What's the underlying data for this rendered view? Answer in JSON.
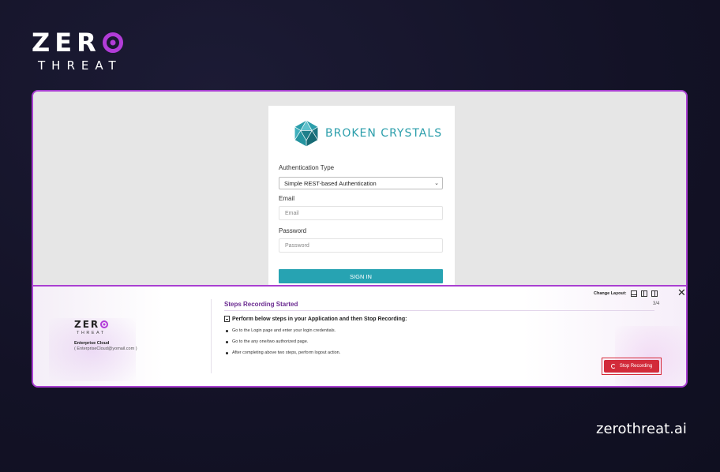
{
  "brand": {
    "word_top_prefix": "ZER",
    "word_bottom": "THREAT"
  },
  "login": {
    "logo_title": "BROKEN CRYSTALS",
    "auth_label": "Authentication Type",
    "auth_value": "Simple REST-based Authentication",
    "email_label": "Email",
    "email_placeholder": "Email",
    "password_label": "Password",
    "password_placeholder": "Password",
    "signin_label": "SIGN IN"
  },
  "panel": {
    "mini_brand_prefix": "ZER",
    "mini_brand_bottom": "THREAT",
    "enterprise_name": "Enterprise Cloud",
    "enterprise_email": "( EnterpriseCloud@yomail.com )",
    "title": "Steps Recording Started",
    "change_layout_label": "Change Layout:",
    "step_count": "3/4",
    "close_glyph": "✕",
    "instruction": "Perform below steps in your Application and then Stop Recording:",
    "steps": [
      "Go to the Login page and enter your login credentials.",
      "Go to the any one/two authorized page.",
      "After completing above two steps, perform logout action."
    ],
    "stop_label": "Stop Recording"
  },
  "footer": {
    "site": "zerothreat.ai"
  },
  "colors": {
    "accent": "#a93fd1",
    "teal": "#27a3b2",
    "stop": "#d22b3a",
    "background": "#15152a"
  }
}
